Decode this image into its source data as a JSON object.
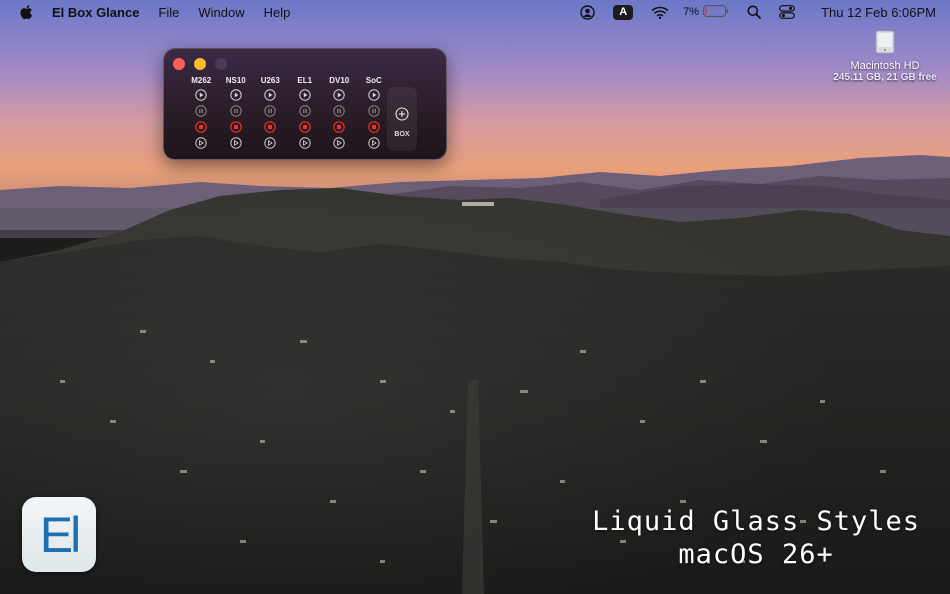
{
  "menubar": {
    "app_name": "El Box Glance",
    "menus": [
      "File",
      "Window",
      "Help"
    ],
    "input_source": "A",
    "battery_percent": "7%",
    "battery_level": 0.07,
    "clock": "Thu 12 Feb  6:06PM"
  },
  "desktop": {
    "disk_name": "Macintosh HD",
    "disk_info": "245.11 GB, 21 GB free"
  },
  "widget": {
    "columns": [
      "M262",
      "NS10",
      "U263",
      "EL1",
      "DV10",
      "SoC"
    ],
    "add_label": "BOX",
    "colors": {
      "play": "#d9d9d9",
      "pause": "#8a8a8a",
      "stop": "#e8342a",
      "reset": "#cfcfcf"
    }
  },
  "promo": {
    "line1": "Liquid Glass Styles",
    "line2": "macOS 26+"
  },
  "app_icon": {
    "text": "El"
  }
}
